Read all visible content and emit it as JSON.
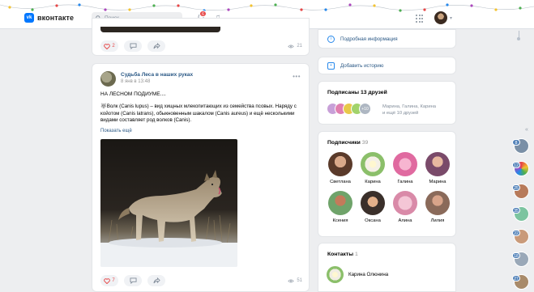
{
  "header": {
    "logo_text": "вконтакте",
    "logo_mark": "vk",
    "search_placeholder": "Поиск",
    "notifications_count": "6"
  },
  "post_top": {
    "likes": "2",
    "views": "21"
  },
  "post_main": {
    "group_name": "Судьба Леса в наших руках",
    "time": "8 янв в 13:48",
    "title": "НА ЛЕСНОМ ПОДИУМЕ....",
    "text": "🐺Волк (Canis lupus) – вид хищных млекопитающих из семейства псовых. Наряду с койотом (Canis latrans), обыкновенным шакалом (Canis aureus) и ещё несколькими видами составляет род волков (Canis).",
    "show_more": "Показать ещё",
    "likes": "7",
    "views": "51"
  },
  "sidebar": {
    "info_link": "Подробная информация",
    "story_link": "Добавить историю",
    "friends_title": "Подписаны 13 друзей",
    "friends_more_badge": "+10",
    "friends_names": "Марина, Галина, Карина",
    "friends_more": "и ещё 10 друзей",
    "subscribers_title": "Подписчики",
    "subscribers_count": "39",
    "subscribers": [
      {
        "name": "Светлана"
      },
      {
        "name": "Карина"
      },
      {
        "name": "Галина"
      },
      {
        "name": "Марина"
      },
      {
        "name": "Ксения"
      },
      {
        "name": "Оксана"
      },
      {
        "name": "Алина"
      },
      {
        "name": "Лилия"
      }
    ],
    "contacts_title": "Контакты",
    "contacts_count": "1",
    "contact_name": "Карина Олюнина"
  },
  "side_badges": [
    "8",
    "12",
    "25",
    "35",
    "22",
    "18",
    "27"
  ],
  "colors": {
    "accent": "#0077ff",
    "like": "#e64646",
    "link": "#2a5885"
  }
}
